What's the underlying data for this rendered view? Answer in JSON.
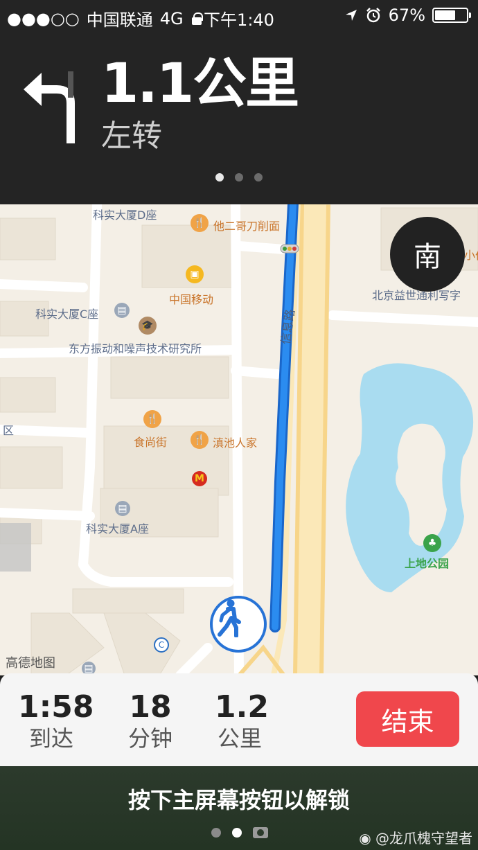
{
  "status_bar": {
    "signal": "●●●○○",
    "carrier": "中国联通",
    "network": "4G",
    "time": "下午1:40",
    "battery_percent": "67%",
    "battery_level": 0.67
  },
  "navigation": {
    "distance": "1.1公里",
    "instruction": "左转",
    "page_count": 3,
    "active_page": 0
  },
  "map": {
    "compass": "南",
    "labels": {
      "bldg_d": "科实大厦D座",
      "restaurant_tage": "他二哥刀削面",
      "china_mobile": "中国移动",
      "bldg_c": "科实大厦C座",
      "institute": "东方振动和噪声技术研究所",
      "food_street": "食尚街",
      "dianchi": "滇池人家",
      "bldg_a": "科实大厦A座",
      "road": "信息路",
      "beijing_yishi": "北京益世通利写字",
      "small_clip": "小伯",
      "district_clip": "区",
      "park": "上地公园",
      "map_brand": "高德地图"
    }
  },
  "trip": {
    "arrival_value": "1:58",
    "arrival_label": "到达",
    "minutes_value": "18",
    "minutes_label": "分钟",
    "km_value": "1.2",
    "km_label": "公里",
    "end_label": "结束"
  },
  "lockscreen": {
    "unlock_text": "按下主屏幕按钮以解锁",
    "watermark": "@龙爪槐守望者"
  },
  "colors": {
    "route": "#2b8cf0",
    "end_button": "#f0474c",
    "water": "#a9dcf0",
    "poi": "#f0a347"
  }
}
